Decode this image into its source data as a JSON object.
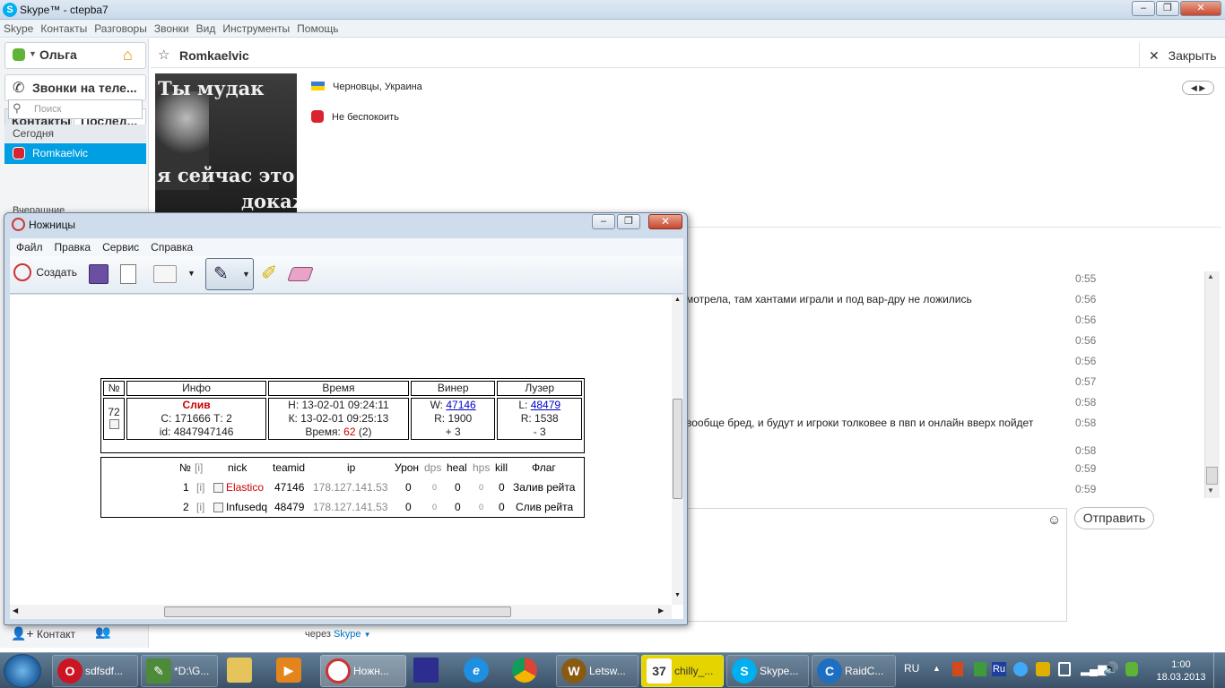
{
  "skype": {
    "title": "Skype™ - ctepba7",
    "menu": [
      "Skype",
      "Контакты",
      "Разговоры",
      "Звонки",
      "Вид",
      "Инструменты",
      "Помощь"
    ],
    "status_name": "Ольга",
    "calls_label": "Звонки на теле...",
    "tab_contacts": "Контакты",
    "tab_recent": "Послед...",
    "search_placeholder": "Поиск",
    "section_today": "Сегодня",
    "selected_contact": "Romkaelvic",
    "cut_label": "Вчерашние",
    "add_contact_label": "Контакт",
    "contact_name": "Romkaelvic",
    "close_label": "Закрыть",
    "location": "Черновцы, Украина",
    "status_text": "Не беспокоить",
    "avatar_line1": "Ты мудак",
    "avatar_line2": "я сейчас это",
    "avatar_line3": "докажу",
    "messages": [
      {
        "text": "",
        "time": "0:55"
      },
      {
        "text": "мотрела, там хантами играли и под вар-дру не ложились",
        "time": "0:56"
      },
      {
        "text": "",
        "time": "0:56"
      },
      {
        "text": "",
        "time": "0:56"
      },
      {
        "text": "",
        "time": "0:56"
      },
      {
        "text": "",
        "time": "0:57"
      },
      {
        "text": "",
        "time": "0:58"
      },
      {
        "text": "вообще бред, и будут и игроки толковее в пвп и онлайн вверх пойдет",
        "time": "0:58"
      },
      {
        "text": "",
        "time": "0:58"
      },
      {
        "text": "",
        "time": "0:59"
      },
      {
        "text": "",
        "time": "0:59"
      }
    ],
    "send_label": "Отправить",
    "via_prefix": "через",
    "via_link": "Skype"
  },
  "snip": {
    "title": "Ножницы",
    "menu": [
      "Файл",
      "Правка",
      "Сервис",
      "Справка"
    ],
    "new_label": "Создать"
  },
  "game": {
    "headers": [
      "№",
      "Инфо",
      "Время",
      "Винер",
      "Лузер"
    ],
    "num": "72",
    "result": "Слив",
    "info_line2": "С: 171666 Т: 2",
    "info_line3": "id: 4847947146",
    "time_h": "Н: 13-02-01 09:24:11",
    "time_k": "К: 13-02-01 09:25:13",
    "time_dur_label": "Время:",
    "time_dur_val": "62",
    "time_dur_extra": "(2)",
    "w_label": "W:",
    "w_id": "47146",
    "w_r": "R: 1900",
    "w_delta": "+ 3",
    "l_label": "L:",
    "l_id": "48479",
    "l_r": "R: 1538",
    "l_delta": "- 3"
  },
  "players": {
    "headers": [
      "№",
      "[i]",
      "nick",
      "teamid",
      "ip",
      "Урон",
      "dps",
      "heal",
      "hps",
      "kill",
      "Флаг"
    ],
    "rows": [
      {
        "n": "1",
        "i": "[i]",
        "nick": "Elastico",
        "teamid": "47146",
        "ip": "178.127.141.53",
        "dmg": "0",
        "dps": "0",
        "heal": "0",
        "hps": "0",
        "kill": "0",
        "flag": "Залив рейта"
      },
      {
        "n": "2",
        "i": "[i]",
        "nick": "Infusedq",
        "teamid": "48479",
        "ip": "178.127.141.53",
        "dmg": "0",
        "dps": "0",
        "heal": "0",
        "hps": "0",
        "kill": "0",
        "flag": "Слив рейта"
      }
    ]
  },
  "taskbar": {
    "items": [
      "sdfsdf...",
      "*D:\\G...",
      "",
      "",
      "Ножн...",
      "",
      "",
      "",
      "Letsw...",
      "chilly_...",
      "Skype...",
      "RaidC..."
    ],
    "lang": "RU",
    "time": "1:00",
    "date": "18.03.2013"
  }
}
